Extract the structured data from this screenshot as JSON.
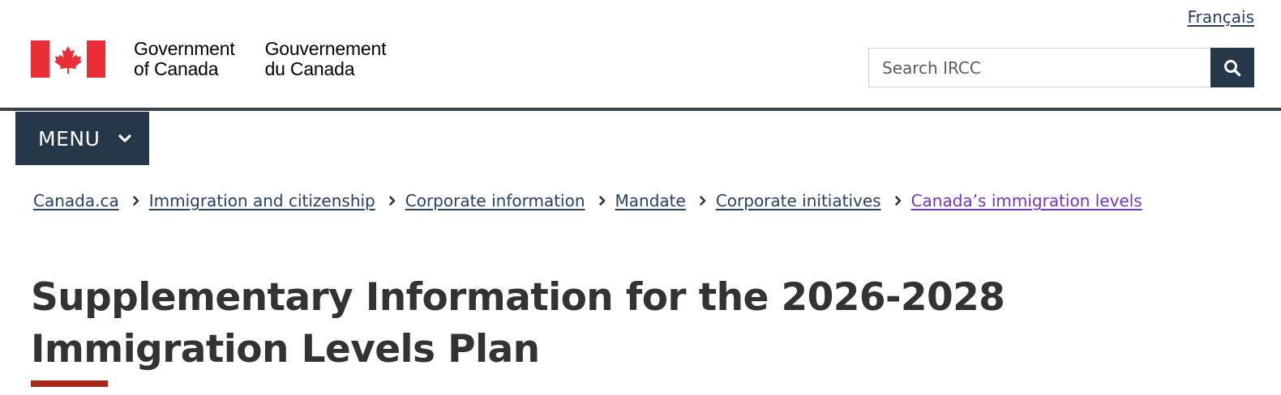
{
  "header": {
    "language_toggle": "Français",
    "wordmark_en": [
      "Government",
      "of Canada"
    ],
    "wordmark_fr": [
      "Gouvernement",
      "du Canada"
    ],
    "search": {
      "placeholder": "Search IRCC",
      "value": "",
      "button_icon": "search-icon"
    },
    "colors": {
      "flag_red": "#eb2d37",
      "nav_dark": "#26374a",
      "link": "#284162",
      "visited_link": "#7834bc",
      "title_accent": "#a62a1e"
    }
  },
  "menu": {
    "label": "MENU",
    "icon": "chevron-down-icon"
  },
  "breadcrumb": {
    "separator_icon": "chevron-right-icon",
    "items": [
      "Canada.ca",
      "Immigration and citizenship",
      "Corporate information",
      "Mandate",
      "Corporate initiatives",
      "Canada’s immigration levels"
    ]
  },
  "main": {
    "title": "Supplementary Information for the 2026-2028 Immigration Levels Plan"
  }
}
